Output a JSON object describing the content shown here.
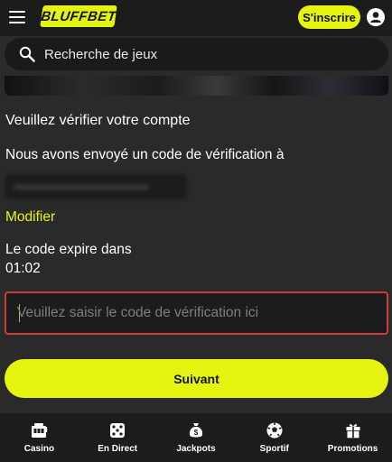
{
  "header": {
    "logo_text": "BLUFFBET",
    "signup_label": "S'inscrire"
  },
  "search": {
    "placeholder": "Recherche de jeux"
  },
  "verify": {
    "title": "Veuillez vérifier votre compte",
    "sent_text": "Nous avons envoyé un code de vérification à",
    "modify_link": "Modifier",
    "expires_text": "Le code expire dans",
    "timer": "01:02",
    "code_placeholder": "Veuillez saisir le code de vérification ici",
    "next_label": "Suivant"
  },
  "bottom_nav": {
    "items": [
      {
        "label": "Casino",
        "icon": "casino-icon"
      },
      {
        "label": "En Direct",
        "icon": "dice-icon"
      },
      {
        "label": "Jackpots",
        "icon": "money-bag-icon"
      },
      {
        "label": "Sportif",
        "icon": "soccer-ball-icon"
      },
      {
        "label": "Promotions",
        "icon": "gift-icon"
      }
    ]
  },
  "colors": {
    "accent": "#e4f40e",
    "background": "#2a2a2a",
    "surface": "#1c1c1c",
    "error_border": "#d03b3b"
  }
}
